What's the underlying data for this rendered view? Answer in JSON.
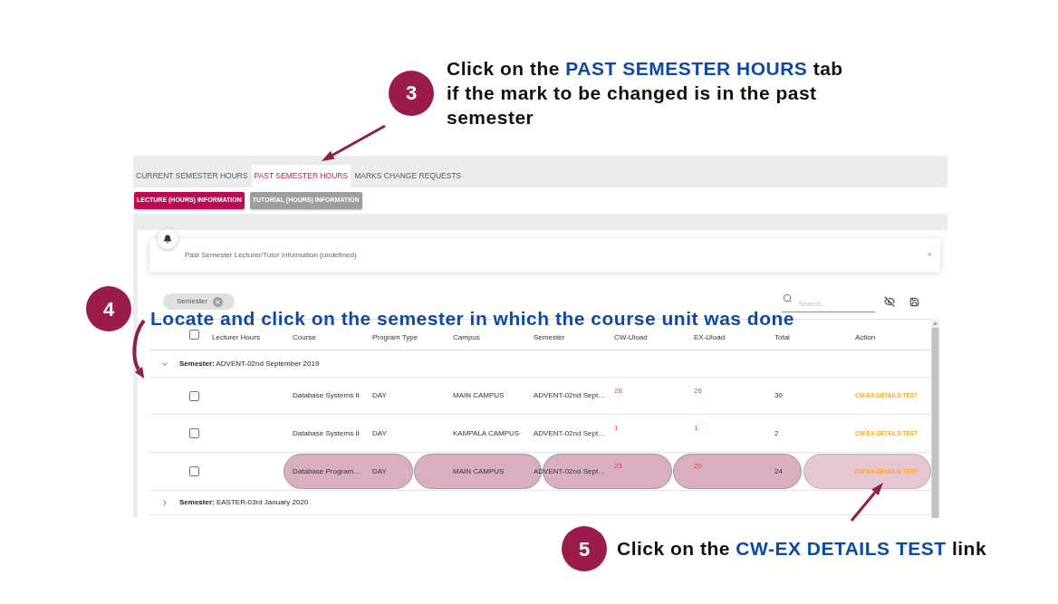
{
  "annotations": [
    {
      "step": "3",
      "segments": [
        {
          "text": "Click on the ",
          "highlight": false
        },
        {
          "text": "PAST SEMESTER HOURS",
          "highlight": true
        },
        {
          "text": " tab if the mark to be changed is in the past semester",
          "highlight": false
        }
      ]
    },
    {
      "step": "4",
      "segments": [
        {
          "text": "Locate and click on the semester in which the course unit was done",
          "highlight": true
        }
      ]
    },
    {
      "step": "5",
      "segments": [
        {
          "text": "Click on the ",
          "highlight": false
        },
        {
          "text": "CW-EX DETAILS TEST",
          "highlight": true
        },
        {
          "text": " link",
          "highlight": false
        }
      ]
    }
  ],
  "tabs": [
    {
      "label": "CURRENT SEMESTER HOURS",
      "selected": false
    },
    {
      "label": "PAST SEMESTER HOURS",
      "selected": true
    },
    {
      "label": "MARKS CHANGE REQUESTS",
      "selected": false
    }
  ],
  "sub_tabs": [
    {
      "label": "LECTURE (HOURS) INFORMATION",
      "selected": true
    },
    {
      "label": "TUTORIAL (HOURS) INFORMATION",
      "selected": false
    }
  ],
  "notification": {
    "text": "Past Semester Lecturer/Tutor Information (undefined)",
    "close": "×"
  },
  "filter_chips": [
    {
      "label": "Semester"
    }
  ],
  "search": {
    "placeholder": "Search..."
  },
  "table": {
    "header_checked": false,
    "columns": [
      "Lecturer Hours",
      "Course",
      "Program Type",
      "Campus",
      "Semester",
      "CW-Uload",
      "EX-Uload",
      "Total",
      "Action"
    ],
    "groups": [
      {
        "label": "**Semester:** ADVENT-02nd September 2019",
        "expanded": true,
        "rows": [
          {
            "checked": false,
            "highlighted": false,
            "course": "Database Systems II",
            "program_type": "DAY",
            "campus": "MAIN CAMPUS",
            "semester": "ADVENT-02nd Sept…",
            "cw_uload": "28",
            "ex_uload": "26",
            "total": "30",
            "action": "CW-EX DETAILS TEST"
          },
          {
            "checked": false,
            "highlighted": false,
            "course": "Database Systems II",
            "program_type": "DAY",
            "campus": "KAMPALA CAMPUS",
            "semester": "ADVENT-02nd Sept…",
            "cw_uload": "1",
            "ex_uload": "1",
            "total": "2",
            "action": "CW-EX DETAILS TEST"
          },
          {
            "checked": false,
            "highlighted": true,
            "course": "Database Program…",
            "program_type": "DAY",
            "campus": "MAIN CAMPUS",
            "semester": "ADVENT-02nd Sept…",
            "cw_uload": "23",
            "ex_uload": "20",
            "total": "24",
            "action": "CW-EX DETAILS TEST"
          }
        ]
      },
      {
        "label": "**Semester:** EASTER-03rd January 2020",
        "expanded": false
      }
    ]
  }
}
